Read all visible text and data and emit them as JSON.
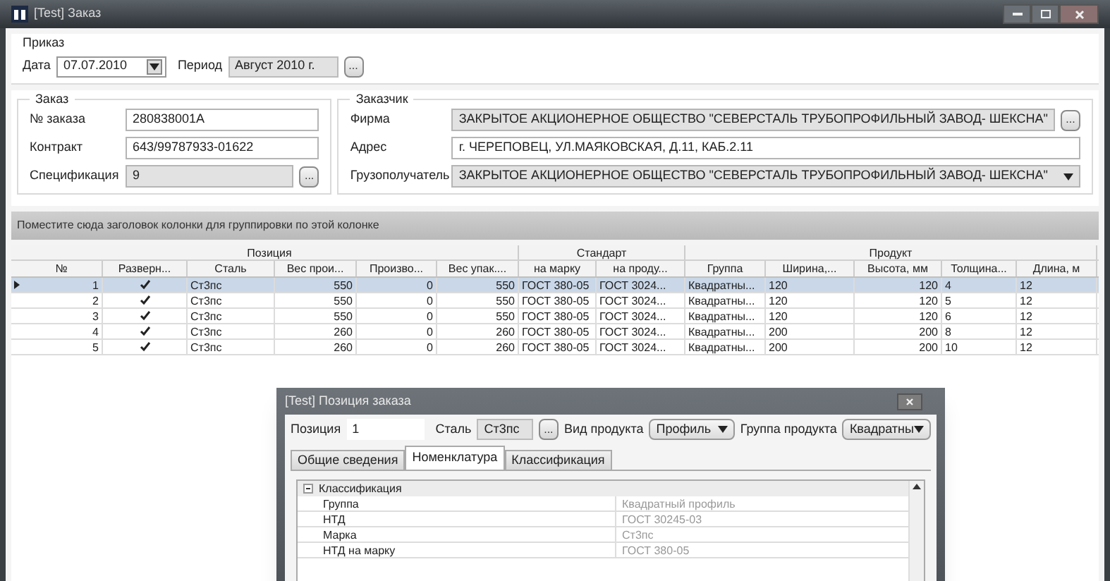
{
  "window": {
    "title": "[Test] Заказ"
  },
  "order_group": {
    "title": "Приказ",
    "date_label": "Дата",
    "date_value": "07.07.2010",
    "period_label": "Период",
    "period_value": "Август 2010 г.",
    "browse": "..."
  },
  "order": {
    "title": "Заказ",
    "fields": [
      {
        "label": "№ заказа",
        "value": "280838001A",
        "kind": "text"
      },
      {
        "label": "Контракт",
        "value": "643/99787933-01622",
        "kind": "text"
      },
      {
        "label": "Спецификация",
        "value": "9",
        "kind": "lookup",
        "browse": "..."
      }
    ]
  },
  "customer": {
    "title": "Заказчик",
    "fields": [
      {
        "label": "Фирма",
        "value": "ЗАКРЫТОЕ АКЦИОНЕРНОЕ ОБЩЕСТВО \"СЕВЕРСТАЛЬ ТРУБОПРОФИЛЬНЫЙ ЗАВОД- ШЕКСНА\"",
        "kind": "lookup",
        "browse": "..."
      },
      {
        "label": "Адрес",
        "value": "г. ЧЕРЕПОВЕЦ, УЛ.МАЯКОВСКАЯ, Д.11, КАБ.2.11",
        "kind": "text"
      },
      {
        "label": "Грузополучатель",
        "value": "ЗАКРЫТОЕ АКЦИОНЕРНОЕ ОБЩЕСТВО \"СЕВЕРСТАЛЬ ТРУБОПРОФИЛЬНЫЙ ЗАВОД- ШЕКСНА\"",
        "kind": "select"
      }
    ]
  },
  "group_panel": "Поместите сюда заголовок колонки для группировки по этой колонке",
  "table": {
    "bands": [
      {
        "label": "Позиция"
      },
      {
        "label": "Стандарт"
      },
      {
        "label": "Продукт"
      }
    ],
    "columns": [
      {
        "label": "№",
        "kind": "number"
      },
      {
        "label": "Разверн...",
        "kind": "check"
      },
      {
        "label": "Сталь",
        "kind": "text"
      },
      {
        "label": "Вес прои...",
        "kind": "number"
      },
      {
        "label": "Произво...",
        "kind": "number"
      },
      {
        "label": "Вес упак....",
        "kind": "number"
      },
      {
        "label": "на марку",
        "kind": "text"
      },
      {
        "label": "на проду...",
        "kind": "text"
      },
      {
        "label": "Группа",
        "kind": "text"
      },
      {
        "label": "Ширина,...",
        "kind": "text"
      },
      {
        "label": "Высота, мм",
        "kind": "number"
      },
      {
        "label": "Толщина...",
        "kind": "text"
      },
      {
        "label": "Длина, м",
        "kind": "text"
      }
    ],
    "rows": [
      {
        "selected": true,
        "cells": [
          "1",
          true,
          "Ст3пс",
          "550",
          "0",
          "550",
          "ГОСТ 380-05",
          "ГОСТ 3024...",
          "Квадратны...",
          "120",
          "120",
          "4",
          "12"
        ]
      },
      {
        "selected": false,
        "cells": [
          "2",
          true,
          "Ст3пс",
          "550",
          "0",
          "550",
          "ГОСТ 380-05",
          "ГОСТ 3024...",
          "Квадратны...",
          "120",
          "120",
          "5",
          "12"
        ]
      },
      {
        "selected": false,
        "cells": [
          "3",
          true,
          "Ст3пс",
          "550",
          "0",
          "550",
          "ГОСТ 380-05",
          "ГОСТ 3024...",
          "Квадратны...",
          "120",
          "120",
          "6",
          "12"
        ]
      },
      {
        "selected": false,
        "cells": [
          "4",
          true,
          "Ст3пс",
          "260",
          "0",
          "260",
          "ГОСТ 380-05",
          "ГОСТ 3024...",
          "Квадратны...",
          "200",
          "200",
          "8",
          "12"
        ]
      },
      {
        "selected": false,
        "cells": [
          "5",
          true,
          "Ст3пс",
          "260",
          "0",
          "260",
          "ГОСТ 380-05",
          "ГОСТ 3024...",
          "Квадратны...",
          "200",
          "200",
          "10",
          "12"
        ]
      }
    ]
  },
  "dialog": {
    "title": "[Test] Позиция заказа",
    "position_label": "Позиция",
    "position_value": "1",
    "steel_label": "Сталь",
    "steel_value": "Ст3пс",
    "browse": "...",
    "product_type_label": "Вид продукта",
    "product_type_value": "Профиль",
    "product_group_label": "Группа продукта",
    "product_group_value": "Квадратны",
    "tabs": [
      {
        "label": "Общие сведения",
        "selected": false
      },
      {
        "label": "Номенклатура",
        "selected": true
      },
      {
        "label": "Классификация",
        "selected": false
      }
    ],
    "properties": {
      "category": "Классификация",
      "expanded": true,
      "rows": [
        {
          "name": "Группа",
          "value": "Квадратный профиль"
        },
        {
          "name": "НТД",
          "value": "ГОСТ 30245-03"
        },
        {
          "name": "Марка",
          "value": "Ст3пс"
        },
        {
          "name": "НТД на марку",
          "value": "ГОСТ 380-05"
        }
      ]
    }
  }
}
